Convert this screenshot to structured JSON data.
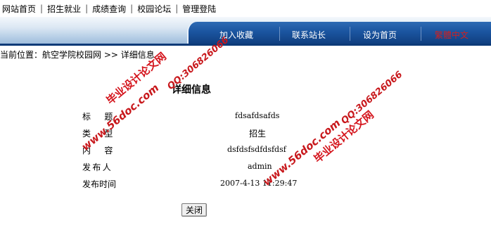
{
  "nav": {
    "home": "网站首页",
    "jobs": "招生就业",
    "grades": "成绩查询",
    "forum": "校园论坛",
    "admin": "管理登陆",
    "separator": "|"
  },
  "banner": {
    "favorite": "加入收藏",
    "contact": "联系站长",
    "homepage": "设为首页",
    "language": "繁體中文"
  },
  "breadcrumb": {
    "prefix": "当前位置：",
    "site": "航空学院校园网",
    "arrow": ">>",
    "current": "详细信息"
  },
  "detail": {
    "title": "详细信息",
    "rows": [
      {
        "label": "标  题",
        "value": "fdsafdsafds"
      },
      {
        "label": "类  型",
        "value": "招生"
      },
      {
        "label": "内  容",
        "value": "dsfdsfsdfdsfdsf"
      },
      {
        "label": "发布人",
        "value": "admin"
      },
      {
        "label": "发布时间",
        "value": "2007-4-13 11:29:47"
      }
    ],
    "close_label": "关闭"
  },
  "watermarks": {
    "site_name": "毕业设计论文网",
    "url": "www.56doc.com",
    "qq": "QQ:306826066"
  },
  "colors": {
    "banner_dark": "#1b55a0",
    "watermark_red": "#d4141c",
    "language_link": "#d02020"
  }
}
